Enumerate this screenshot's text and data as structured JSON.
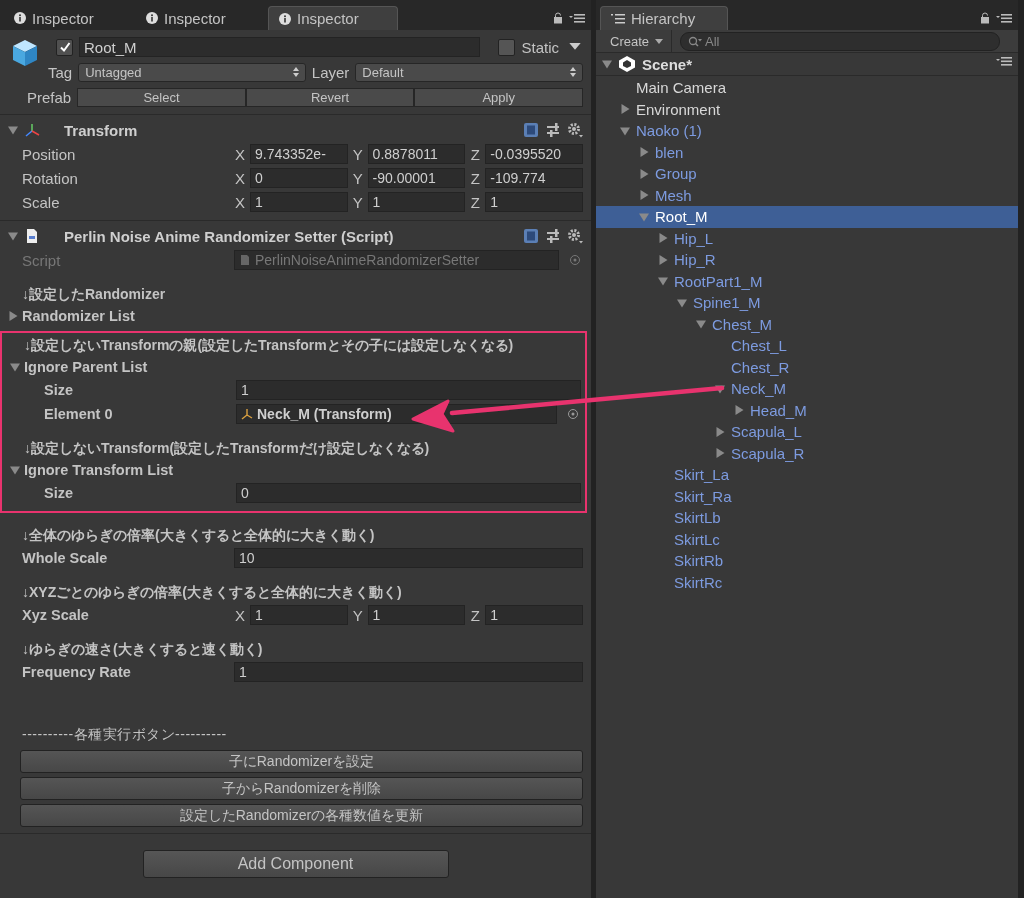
{
  "inspector": {
    "tabs": [
      {
        "label": "Inspector",
        "selected": false
      },
      {
        "label": "Inspector",
        "selected": false
      },
      {
        "label": "Inspector",
        "selected": true
      }
    ],
    "object": {
      "active": true,
      "name": "Root_M",
      "static_label": "Static",
      "static": false,
      "tag_label": "Tag",
      "tag": "Untagged",
      "layer_label": "Layer",
      "layer": "Default",
      "prefab_label": "Prefab",
      "prefab_buttons": [
        "Select",
        "Revert",
        "Apply"
      ]
    },
    "transform": {
      "expanded": true,
      "title": "Transform",
      "rows": [
        {
          "label": "Position",
          "axes": [
            {
              "axis": "X",
              "value": "9.743352e-"
            },
            {
              "axis": "Y",
              "value": "0.8878011"
            },
            {
              "axis": "Z",
              "value": "-0.0395520"
            }
          ]
        },
        {
          "label": "Rotation",
          "axes": [
            {
              "axis": "X",
              "value": "0"
            },
            {
              "axis": "Y",
              "value": "-90.00001"
            },
            {
              "axis": "Z",
              "value": "-109.774"
            }
          ]
        },
        {
          "label": "Scale",
          "axes": [
            {
              "axis": "X",
              "value": "1"
            },
            {
              "axis": "Y",
              "value": "1"
            },
            {
              "axis": "Z",
              "value": "1"
            }
          ]
        }
      ]
    },
    "script_component": {
      "expanded": true,
      "title": "Perlin Noise Anime Randomizer Setter (Script)",
      "script_label": "Script",
      "script_value": "PerlinNoiseAnimeRandomizerSetter",
      "properties": [
        {
          "kind": "note",
          "text": "↓設定したRandomizer"
        },
        {
          "kind": "foldout",
          "label": "Randomizer List",
          "expanded": false
        },
        {
          "kind": "group",
          "highlighted": true,
          "items": [
            {
              "kind": "note",
              "text": "↓設定しないTransformの親(設定したTransformとその子には設定しなくなる)"
            },
            {
              "kind": "foldout",
              "label": "Ignore Parent List",
              "expanded": true,
              "children": [
                {
                  "kind": "field",
                  "label": "Size",
                  "value": "1"
                },
                {
                  "kind": "object_field",
                  "label": "Element 0",
                  "value": "Neck_M (Transform)"
                }
              ]
            },
            {
              "kind": "note",
              "text": "↓設定しないTransform(設定したTransformだけ設定しなくなる)"
            },
            {
              "kind": "foldout",
              "label": "Ignore Transform List",
              "expanded": true,
              "children": [
                {
                  "kind": "field",
                  "label": "Size",
                  "value": "0"
                }
              ]
            }
          ]
        },
        {
          "kind": "note",
          "text": "↓全体のゆらぎの倍率(大きくすると全体的に大きく動く)"
        },
        {
          "kind": "field",
          "label": "Whole Scale",
          "value": "10"
        },
        {
          "kind": "note",
          "text": "↓XYZごとのゆらぎの倍率(大きくすると全体的に大きく動く)"
        },
        {
          "kind": "vector",
          "label": "Xyz Scale",
          "axes": [
            {
              "axis": "X",
              "value": "1"
            },
            {
              "axis": "Y",
              "value": "1"
            },
            {
              "axis": "Z",
              "value": "1"
            }
          ]
        },
        {
          "kind": "note",
          "text": "↓ゆらぎの速さ(大きくすると速く動く)"
        },
        {
          "kind": "field",
          "label": "Frequency Rate",
          "value": "1"
        },
        {
          "kind": "divider",
          "text": "----------各種実行ボタン----------"
        },
        {
          "kind": "button",
          "label": "子にRandomizerを設定"
        },
        {
          "kind": "button",
          "label": "子からRandomizerを削除"
        },
        {
          "kind": "button",
          "label": "設定したRandomizerの各種数値を更新"
        }
      ]
    },
    "add_component": "Add Component"
  },
  "hierarchy": {
    "tab": "Hierarchy",
    "create": "Create",
    "search_placeholder": "All",
    "scene": {
      "name": "Scene*",
      "expanded": true
    },
    "items": [
      {
        "name": "Main Camera",
        "prefab": false,
        "selected": false
      },
      {
        "name": "Environment",
        "prefab": false,
        "selected": false,
        "expanded": false
      },
      {
        "name": "Naoko (1)",
        "prefab": true,
        "selected": false,
        "expanded": true,
        "children": [
          {
            "name": "blen",
            "prefab": true,
            "selected": false,
            "expanded": false
          },
          {
            "name": "Group",
            "prefab": true,
            "selected": false,
            "expanded": false
          },
          {
            "name": "Mesh",
            "prefab": true,
            "selected": false,
            "expanded": false
          },
          {
            "name": "Root_M",
            "prefab": true,
            "selected": true,
            "expanded": true,
            "children": [
              {
                "name": "Hip_L",
                "prefab": true,
                "selected": false,
                "expanded": false
              },
              {
                "name": "Hip_R",
                "prefab": true,
                "selected": false,
                "expanded": false
              },
              {
                "name": "RootPart1_M",
                "prefab": true,
                "selected": false,
                "expanded": true,
                "children": [
                  {
                    "name": "Spine1_M",
                    "prefab": true,
                    "selected": false,
                    "expanded": true,
                    "children": [
                      {
                        "name": "Chest_M",
                        "prefab": true,
                        "selected": false,
                        "expanded": true,
                        "children": [
                          {
                            "name": "Chest_L",
                            "prefab": true,
                            "selected": false
                          },
                          {
                            "name": "Chest_R",
                            "prefab": true,
                            "selected": false
                          },
                          {
                            "name": "Neck_M",
                            "prefab": true,
                            "selected": false,
                            "expanded": true,
                            "children": [
                              {
                                "name": "Head_M",
                                "prefab": true,
                                "selected": false,
                                "expanded": false
                              }
                            ]
                          },
                          {
                            "name": "Scapula_L",
                            "prefab": true,
                            "selected": false,
                            "expanded": false
                          },
                          {
                            "name": "Scapula_R",
                            "prefab": true,
                            "selected": false,
                            "expanded": false
                          }
                        ]
                      }
                    ]
                  }
                ]
              },
              {
                "name": "Skirt_La",
                "prefab": true,
                "selected": false
              },
              {
                "name": "Skirt_Ra",
                "prefab": true,
                "selected": false
              },
              {
                "name": "SkirtLb",
                "prefab": true,
                "selected": false
              },
              {
                "name": "SkirtLc",
                "prefab": true,
                "selected": false
              },
              {
                "name": "SkirtRb",
                "prefab": true,
                "selected": false
              },
              {
                "name": "SkirtRc",
                "prefab": true,
                "selected": false
              }
            ]
          }
        ]
      }
    ]
  }
}
